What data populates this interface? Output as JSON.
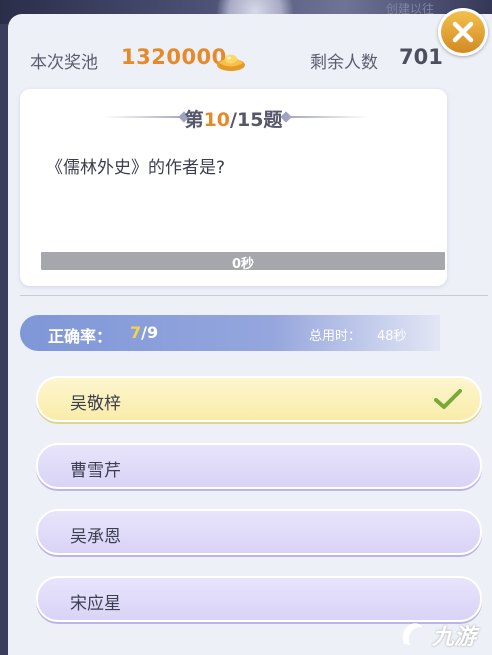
{
  "top_hint": "创建以往",
  "header": {
    "pool_label": "本次奖池",
    "pool_value": "1320000",
    "remaining_label": "剩余人数",
    "remaining_value": "701"
  },
  "question": {
    "number_prefix": "第",
    "current": "10",
    "total": "/15",
    "suffix": "题",
    "text": "《儒林外史》的作者是?",
    "timer_text": "0秒",
    "timer_fraction": 0
  },
  "stats": {
    "accuracy_label": "正确率：",
    "accuracy_correct": "7",
    "accuracy_total": "/9",
    "time_label": "总用时：",
    "time_value": "48秒"
  },
  "options": [
    {
      "label": "吴敬梓",
      "state": "correct"
    },
    {
      "label": "曹雪芹",
      "state": "plain"
    },
    {
      "label": "吴承恩",
      "state": "plain"
    },
    {
      "label": "宋应星",
      "state": "plain"
    }
  ],
  "watermark": "九游",
  "colors": {
    "accent_orange": "#e58a2a",
    "correct_option": "#f9eca9",
    "plain_option": "#d9d3f6",
    "check_green": "#7aa83a",
    "stats_bar": "#7f97d8"
  },
  "icons": {
    "close": "close-icon",
    "gold": "gold-ingot-icon",
    "check": "checkmark-icon"
  }
}
